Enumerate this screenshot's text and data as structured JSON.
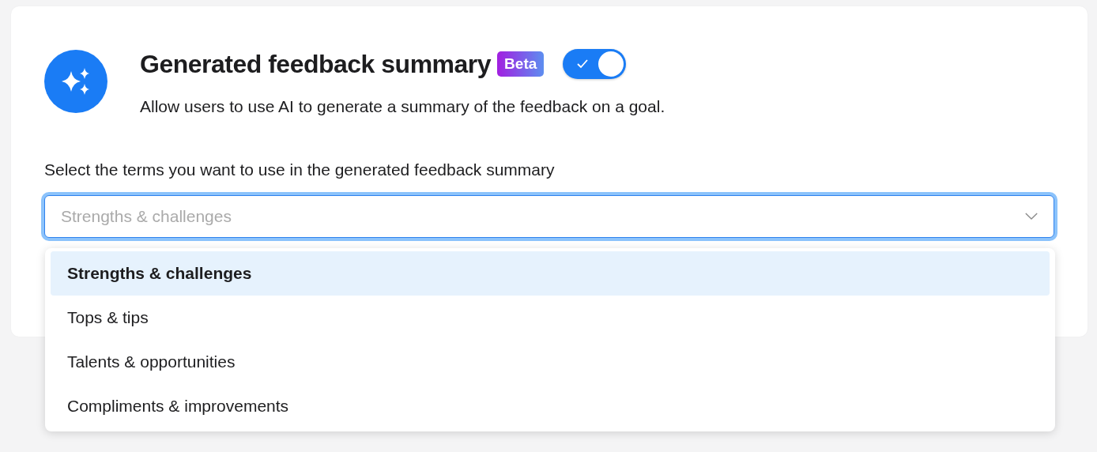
{
  "setting": {
    "title": "Generated feedback summary",
    "badge": "Beta",
    "enabled": true,
    "description": "Allow users to use AI to generate a summary of the feedback on a goal."
  },
  "terms": {
    "label": "Select the terms you want to use in the generated feedback summary",
    "placeholder": "Strengths & challenges",
    "expanded": true,
    "options": [
      {
        "label": "Strengths & challenges",
        "selected": true
      },
      {
        "label": "Tops & tips",
        "selected": false
      },
      {
        "label": "Talents & opportunities",
        "selected": false
      },
      {
        "label": "Compliments & improvements",
        "selected": false
      }
    ]
  }
}
